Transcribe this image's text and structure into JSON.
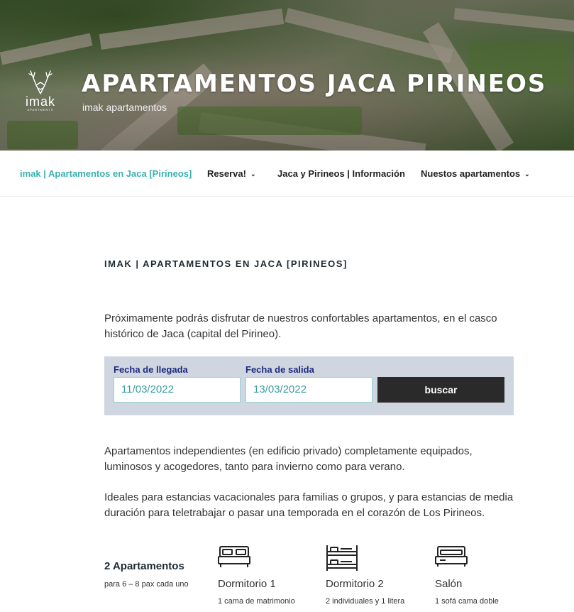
{
  "header": {
    "logo_text": "imak",
    "logo_sub": "APARTMENTS",
    "site_title": "APARTAMENTOS JACA PIRINEOS",
    "site_description": "imak apartamentos"
  },
  "nav": {
    "items": [
      {
        "label": "imak | Apartamentos en Jaca [Pirineos]",
        "active": true
      },
      {
        "label": "Reserva!",
        "dropdown": true
      },
      {
        "label": "Jaca y Pirineos | Información"
      },
      {
        "label": "Nuestos apartamentos",
        "dropdown": true
      }
    ]
  },
  "main": {
    "page_title": "IMAK | APARTAMENTOS EN JACA [PIRINEOS]",
    "intro": "Próximamente podrás disfrutar de nuestros confortables apartamentos, en el casco histórico de Jaca (capital del Pirineo).",
    "booking": {
      "arrival_label": "Fecha de llegada",
      "arrival_value": "11/03/2022",
      "departure_label": "Fecha de salida",
      "departure_value": "13/03/2022",
      "search_label": "buscar"
    },
    "para1": "Apartamentos independientes (en edificio privado) completamente equipados, luminosos y acogedores, tanto para invierno como para verano.",
    "para2": "Ideales para estancias vacacionales para familias o grupos, y para estancias de media duración para teletrabajar o pasar una temporada en el corazón de Los Pirineos.",
    "features": {
      "heading": "2 Apartamentos",
      "subheading": "para 6 – 8 pax cada uno",
      "items": [
        {
          "icon": "double-bed-icon",
          "title": "Dormitorio 1",
          "desc": "1 cama de matrimonio"
        },
        {
          "icon": "bunk-bed-icon",
          "title": "Dormitorio 2",
          "desc": "2 individuales y 1 litera"
        },
        {
          "icon": "sofa-bed-icon",
          "title": "Salón",
          "desc": "1 sofá cama doble"
        }
      ]
    }
  },
  "colors": {
    "accent": "#3ab0b1",
    "booking_bg": "#d0d6e0",
    "booking_label": "#1e2a80",
    "button_bg": "#2a2a2a"
  }
}
